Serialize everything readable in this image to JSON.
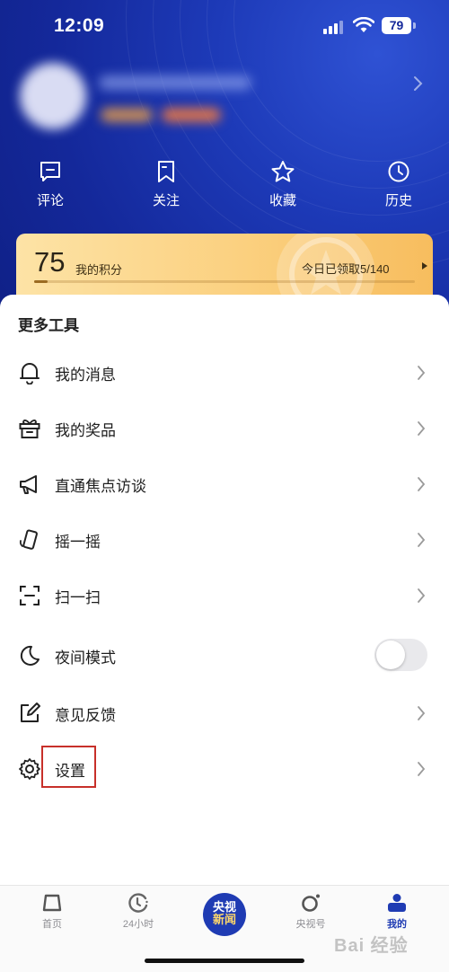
{
  "status_bar": {
    "time": "12:09",
    "battery": "79"
  },
  "quick_actions": [
    {
      "label": "评论",
      "icon": "comment-icon"
    },
    {
      "label": "关注",
      "icon": "bookmark-icon"
    },
    {
      "label": "收藏",
      "icon": "star-icon"
    },
    {
      "label": "历史",
      "icon": "clock-icon"
    }
  ],
  "points_card": {
    "value": "75",
    "label": "我的积分",
    "claimed_text": "今日已领取5/140",
    "claimed_fraction": 0.036
  },
  "more_tools": {
    "title": "更多工具",
    "items": [
      {
        "label": "我的消息",
        "icon": "bell-icon"
      },
      {
        "label": "我的奖品",
        "icon": "gift-icon"
      },
      {
        "label": "直通焦点访谈",
        "icon": "megaphone-icon"
      },
      {
        "label": "摇一摇",
        "icon": "shake-phone-icon"
      },
      {
        "label": "扫一扫",
        "icon": "scan-icon"
      },
      {
        "label": "夜间模式",
        "icon": "moon-icon",
        "toggle": false
      },
      {
        "label": "意见反馈",
        "icon": "edit-icon"
      },
      {
        "label": "设置",
        "icon": "gear-icon"
      }
    ]
  },
  "tab_bar": {
    "tabs": [
      {
        "label": "首页",
        "icon": "home-icon"
      },
      {
        "label": "24小时",
        "icon": "24h-clock-icon"
      },
      {
        "label": "",
        "icon": "cctv-news-logo"
      },
      {
        "label": "央视号",
        "icon": "cctv-account-icon"
      },
      {
        "label": "我的",
        "icon": "profile-icon",
        "active": true
      }
    ],
    "center_logo_line1": "央视",
    "center_logo_line2": "新闻"
  },
  "watermark": "Bai 经验",
  "colors": {
    "brand_blue": "#1f3bb3",
    "card_gold": "#fbd07f",
    "highlight_red": "#c7302a"
  }
}
